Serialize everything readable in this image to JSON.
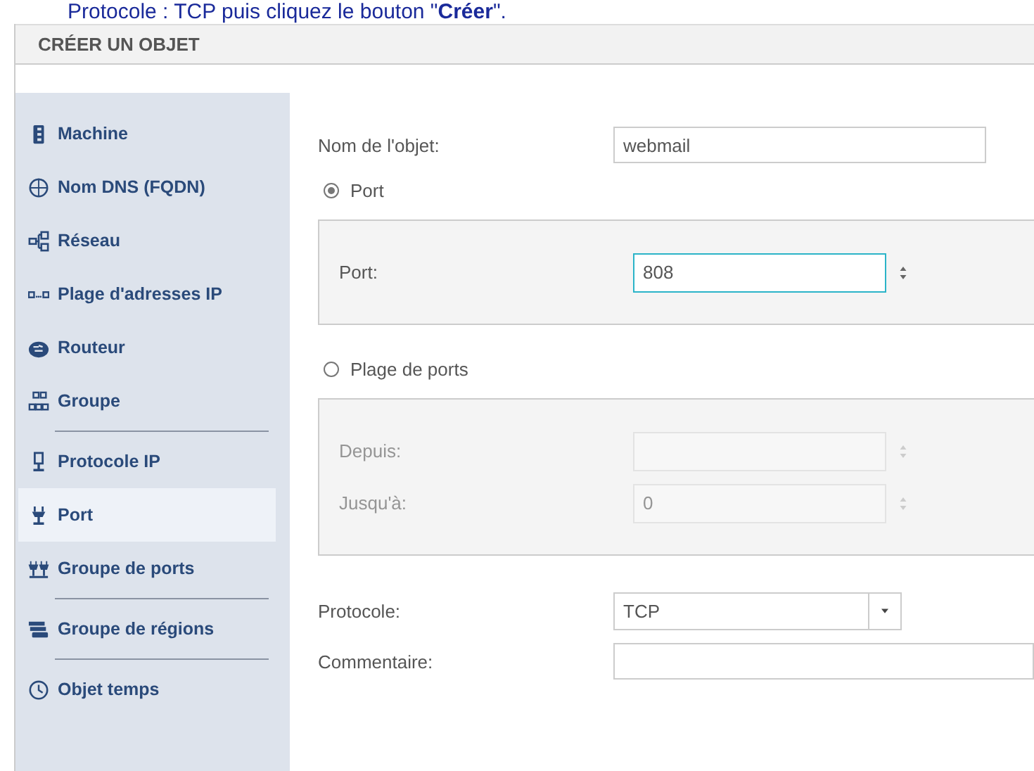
{
  "instruction": "Protocole : TCP puis cliquez le bouton \"**Créer**\".",
  "panel_title": "CRÉER UN OBJET",
  "sidebar": {
    "groups": [
      {
        "items": [
          {
            "label": "Machine",
            "selected": false
          },
          {
            "label": "Nom DNS (FQDN)",
            "selected": false
          },
          {
            "label": "Réseau",
            "selected": false
          },
          {
            "label": "Plage d'adresses IP",
            "selected": false
          },
          {
            "label": "Routeur",
            "selected": false
          },
          {
            "label": "Groupe",
            "selected": false
          }
        ]
      },
      {
        "items": [
          {
            "label": "Protocole IP",
            "selected": false
          },
          {
            "label": "Port",
            "selected": true
          },
          {
            "label": "Groupe de ports",
            "selected": false
          }
        ]
      },
      {
        "items": [
          {
            "label": "Groupe de régions",
            "selected": false
          }
        ]
      },
      {
        "items": [
          {
            "label": "Objet temps",
            "selected": false
          }
        ]
      }
    ]
  },
  "form": {
    "name": {
      "label": "Nom de l'objet:",
      "value": "webmail"
    },
    "modes": [
      {
        "label": "Port",
        "selected": true,
        "fields": [
          {
            "label": "Port:",
            "value": "808",
            "focused": true
          }
        ]
      },
      {
        "label": "Plage de ports",
        "selected": false,
        "fields": [
          {
            "label": "Depuis:",
            "focused": false
          },
          {
            "label": "Jusqu'à:",
            "value": "0",
            "focused": false
          }
        ]
      }
    ],
    "protocol": {
      "label": "Protocole:",
      "value": "TCP"
    },
    "comment": {
      "label": "Commentaire:"
    }
  }
}
